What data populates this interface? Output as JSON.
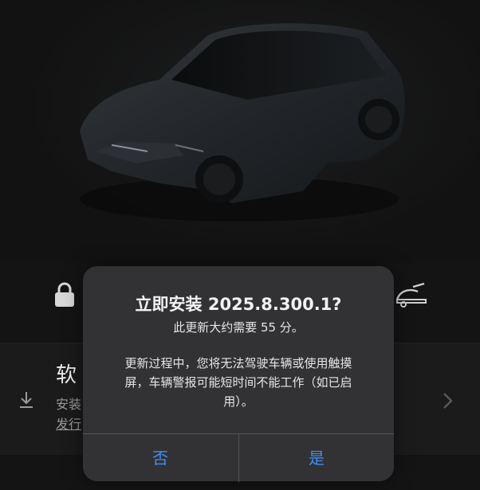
{
  "dialog": {
    "title": "立即安装 2025.8.300.1?",
    "subtitle": "此更新大约需要 55 分。",
    "body": "更新过程中，您将无法驾驶车辆或使用触摸屏，车辆警报可能短时间不能工作（如已启用）。",
    "no_label": "否",
    "yes_label": "是"
  },
  "software_panel": {
    "title": "软",
    "line1": "安装",
    "line2": "发行"
  },
  "icons": {
    "lock": "lock-icon",
    "trunk": "trunk-open-icon",
    "download": "download-icon",
    "chevron": "chevron-right-icon"
  },
  "colors": {
    "accent": "#3e8ef7",
    "background": "#141414",
    "dialog": "#343436"
  }
}
